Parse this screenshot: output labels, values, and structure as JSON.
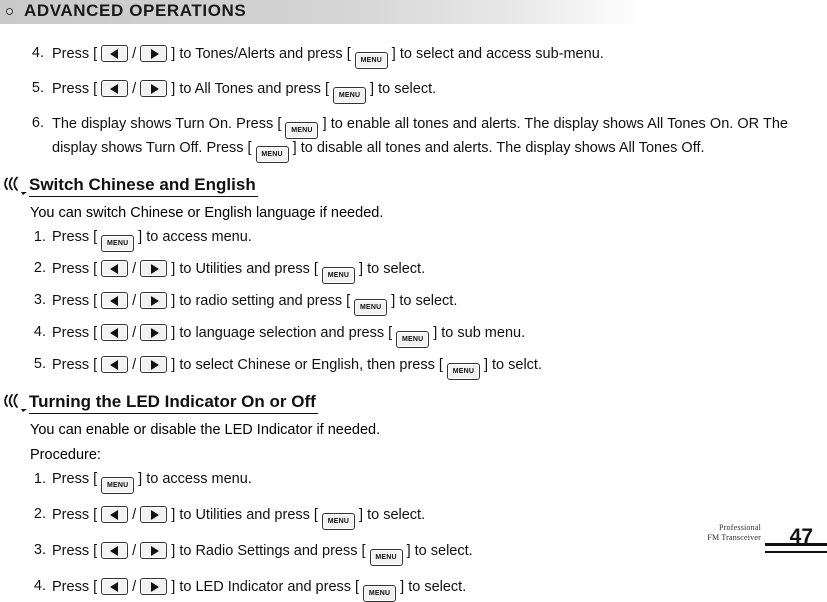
{
  "header": {
    "title": "ADVANCED OPERATIONS",
    "bullet_icon": "circle-icon"
  },
  "top_steps": [
    {
      "num": "4.",
      "parts": [
        {
          "t": "text",
          "v": "Press ["
        },
        {
          "t": "key",
          "v": "left-arrow"
        },
        {
          "t": "text",
          "v": "/"
        },
        {
          "t": "key",
          "v": "right-arrow"
        },
        {
          "t": "text",
          "v": "] to Tones/Alerts and press ["
        },
        {
          "t": "key",
          "v": "MENU"
        },
        {
          "t": "text",
          "v": "] to select and access sub-menu."
        }
      ]
    },
    {
      "num": "5.",
      "parts": [
        {
          "t": "text",
          "v": "Press ["
        },
        {
          "t": "key",
          "v": "left-arrow"
        },
        {
          "t": "text",
          "v": "/"
        },
        {
          "t": "key",
          "v": "right-arrow"
        },
        {
          "t": "text",
          "v": "] to All Tones and press ["
        },
        {
          "t": "key",
          "v": "MENU"
        },
        {
          "t": "text",
          "v": "] to select."
        }
      ]
    },
    {
      "num": "6.",
      "justify": true,
      "parts": [
        {
          "t": "text",
          "v": "The display shows Turn On. Press ["
        },
        {
          "t": "key",
          "v": "MENU"
        },
        {
          "t": "text",
          "v": "] to enable all tones and alerts. The display shows All Tones On. OR The display shows Turn Off. Press ["
        },
        {
          "t": "key",
          "v": "MENU"
        },
        {
          "t": "text",
          "v": "] to disable all tones and alerts. The display shows All Tones Off."
        }
      ]
    }
  ],
  "sections": [
    {
      "icon": "sound-wave-icon",
      "title": "Switch Chinese and English",
      "lead": "You can switch Chinese or English language if needed.",
      "steps": [
        {
          "num": "1.",
          "parts": [
            {
              "t": "text",
              "v": "Press ["
            },
            {
              "t": "key",
              "v": "MENU"
            },
            {
              "t": "text",
              "v": "] to access menu."
            }
          ]
        },
        {
          "num": "2.",
          "parts": [
            {
              "t": "text",
              "v": "Press ["
            },
            {
              "t": "key",
              "v": "left-arrow"
            },
            {
              "t": "text",
              "v": "/"
            },
            {
              "t": "key",
              "v": "right-arrow"
            },
            {
              "t": "text",
              "v": "] to Utilities and press ["
            },
            {
              "t": "key",
              "v": "MENU"
            },
            {
              "t": "text",
              "v": "] to select."
            }
          ]
        },
        {
          "num": "3.",
          "parts": [
            {
              "t": "text",
              "v": "Press ["
            },
            {
              "t": "key",
              "v": "left-arrow"
            },
            {
              "t": "text",
              "v": "/"
            },
            {
              "t": "key",
              "v": "right-arrow"
            },
            {
              "t": "text",
              "v": "] to radio setting and press ["
            },
            {
              "t": "key",
              "v": "MENU"
            },
            {
              "t": "text",
              "v": "] to select."
            }
          ]
        },
        {
          "num": "4.",
          "parts": [
            {
              "t": "text",
              "v": "Press ["
            },
            {
              "t": "key",
              "v": "left-arrow"
            },
            {
              "t": "text",
              "v": "/"
            },
            {
              "t": "key",
              "v": "right-arrow"
            },
            {
              "t": "text",
              "v": "] to language selection and press ["
            },
            {
              "t": "key",
              "v": "MENU"
            },
            {
              "t": "text",
              "v": "] to sub menu."
            }
          ]
        },
        {
          "num": "5.",
          "parts": [
            {
              "t": "text",
              "v": "Press ["
            },
            {
              "t": "key",
              "v": "left-arrow"
            },
            {
              "t": "text",
              "v": "/"
            },
            {
              "t": "key",
              "v": "right-arrow"
            },
            {
              "t": "text",
              "v": "] to select Chinese or English, then press ["
            },
            {
              "t": "key",
              "v": "MENU"
            },
            {
              "t": "text",
              "v": "] to selct."
            }
          ]
        }
      ]
    },
    {
      "icon": "sound-wave-icon",
      "title": "Turning the LED Indicator On or Off",
      "lead": "You can enable or disable the LED Indicator if needed.",
      "lead2": "Procedure:",
      "steps": [
        {
          "num": "1.",
          "parts": [
            {
              "t": "text",
              "v": "Press ["
            },
            {
              "t": "key",
              "v": "MENU"
            },
            {
              "t": "text",
              "v": "] to access menu."
            }
          ]
        },
        {
          "num": "2.",
          "parts": [
            {
              "t": "text",
              "v": "Press ["
            },
            {
              "t": "key",
              "v": "left-arrow"
            },
            {
              "t": "text",
              "v": "/"
            },
            {
              "t": "key",
              "v": "right-arrow"
            },
            {
              "t": "text",
              "v": "] to Utilities and press ["
            },
            {
              "t": "key",
              "v": "MENU"
            },
            {
              "t": "text",
              "v": "] to select."
            }
          ]
        },
        {
          "num": "3.",
          "parts": [
            {
              "t": "text",
              "v": "Press ["
            },
            {
              "t": "key",
              "v": "left-arrow"
            },
            {
              "t": "text",
              "v": "/"
            },
            {
              "t": "key",
              "v": "right-arrow"
            },
            {
              "t": "text",
              "v": "] to Radio Settings and press ["
            },
            {
              "t": "key",
              "v": "MENU"
            },
            {
              "t": "text",
              "v": "] to select."
            }
          ]
        },
        {
          "num": "4.",
          "parts": [
            {
              "t": "text",
              "v": "Press ["
            },
            {
              "t": "key",
              "v": "left-arrow"
            },
            {
              "t": "text",
              "v": "/"
            },
            {
              "t": "key",
              "v": "right-arrow"
            },
            {
              "t": "text",
              "v": "] to LED Indicator and press ["
            },
            {
              "t": "key",
              "v": "MENU"
            },
            {
              "t": "text",
              "v": "] to select."
            }
          ]
        }
      ]
    }
  ],
  "footer": {
    "brand_line1": "Professional",
    "brand_line2": "FM Transceiver",
    "page_number": "47"
  },
  "colors": {
    "text": "#111111",
    "header_band_left": "#c9c9c9",
    "key_fill": "#f2f2f2"
  }
}
